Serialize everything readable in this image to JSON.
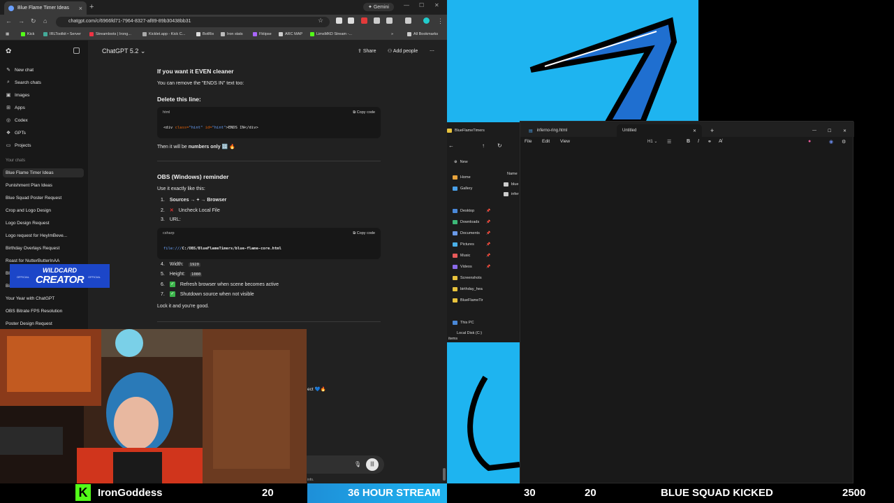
{
  "browser": {
    "tab_title": "Blue Flame Timer Ideas",
    "gemini_label": "Gemini",
    "url": "chatgpt.com/c/6966fd71-7964-8327-af89-89b30438bb31",
    "bookmarks": [
      "Kick",
      "IRLToolkit • Server",
      "Streamloots | Irong...",
      "Kicklet.app - Kick C...",
      "BotRix",
      "Iron stats",
      "Fktipse",
      "ARC MAP",
      "LimsMKD Stream -..."
    ],
    "all_bookmarks": "All Bookmarks"
  },
  "sidebar": {
    "top_items": [
      {
        "icon": "new-chat-icon",
        "label": "New chat"
      },
      {
        "icon": "search-icon",
        "label": "Search chats"
      },
      {
        "icon": "images-icon",
        "label": "Images"
      },
      {
        "icon": "apps-icon",
        "label": "Apps"
      },
      {
        "icon": "codex-icon",
        "label": "Codex"
      },
      {
        "icon": "gpts-icon",
        "label": "GPTs"
      },
      {
        "icon": "projects-icon",
        "label": "Projects"
      }
    ],
    "section_label": "Your chats",
    "chats": [
      "Blue Flame Timer Ideas",
      "Punishment Plan Ideas",
      "Blue Squad Poster Request",
      "Crop and Logo Design",
      "Logo Design Request",
      "Logo request for HeyImBeve...",
      "Birthday Overlays Request",
      "Roast for NutterButterInAA",
      "Bl",
      "Bi",
      "Your Year with ChatGPT",
      "OBS Bitrate FPS Resolution",
      "Poster Design Request"
    ]
  },
  "chat": {
    "model": "ChatGPT 5.2",
    "share": "Share",
    "add_people": "Add people",
    "heading1": "If you want it EVEN cleaner",
    "p1": "You can remove the \"ENDS IN\" text too:",
    "delete_line": "Delete this line:",
    "code1_lang": "html",
    "copy_code": "Copy code",
    "code1_tag_open": "<div ",
    "code1_attr1": "class=",
    "code1_str1": "\"hint\"",
    "code1_attr2": " id=",
    "code1_str2": "\"hint\"",
    "code1_rest": ">ENDS IN</div>",
    "then_prefix": "Then it will be ",
    "then_bold": "numbers only",
    "then_emoji": "🔢 🔥",
    "heading2": "OBS (Windows) reminder",
    "use_exactly": "Use it exactly like this:",
    "steps": [
      {
        "num": "1.",
        "text": "Sources → + → Browser"
      },
      {
        "num": "2.",
        "text": "Uncheck Local File"
      },
      {
        "num": "3.",
        "text": "URL:"
      }
    ],
    "code2_lang": "csharp",
    "code2_prefix": "file:///",
    "code2_path": "C:/OBS/BlueFlameTimers/blue-flame-core.html",
    "width_label": "Width:",
    "width_val": "1920",
    "height_label": "Height:",
    "height_val": "1080",
    "step6": "Refresh browser when scene becomes active",
    "step7": "Shutdown source when not visible",
    "nums_rest": [
      "4.",
      "5.",
      "6.",
      "7."
    ],
    "lock": "Lock it and you're good.",
    "partial": "ect 💙🔥",
    "fineprint": "info."
  },
  "badge": {
    "top": "WILDCARD",
    "main": "CREATOR",
    "side": "OFFICIAL"
  },
  "explorer": {
    "title": "BlueFlameTimers",
    "new": "New",
    "col": "Name",
    "nav": [
      {
        "label": "Home",
        "color": "#e8a33c"
      },
      {
        "label": "Gallery",
        "color": "#4aa0e8"
      },
      {
        "label": "Desktop",
        "color": "#4a88d8"
      },
      {
        "label": "Downloads",
        "color": "#3cb878"
      },
      {
        "label": "Documents",
        "color": "#6a9ae8"
      },
      {
        "label": "Pictures",
        "color": "#4ab0e8"
      },
      {
        "label": "Music",
        "color": "#e85a5a"
      },
      {
        "label": "Videos",
        "color": "#8a6ae8"
      },
      {
        "label": "Screenshots",
        "color": "#e8c23c"
      },
      {
        "label": "birthday_hea",
        "color": "#e8c23c"
      },
      {
        "label": "BlueFlameTir",
        "color": "#e8c23c"
      }
    ],
    "files": [
      "blue",
      "infer"
    ],
    "this_pc": "This PC",
    "local_disk": "Local Disk (C:)",
    "items": "items"
  },
  "notepad": {
    "tabs": [
      "inferno-ring.html",
      "Untitled"
    ],
    "menu": [
      "File",
      "Edit",
      "View"
    ],
    "heading_btn": "H1"
  },
  "ticker": {
    "name": "IronGoddess",
    "n1": "20",
    "stream": "36 HOUR STREAM",
    "n2": "30",
    "n3": "20",
    "kicked": "BLUE SQUAD KICKED",
    "n4": "2500"
  },
  "colors": {
    "accent_blue": "#1eb4f0",
    "kick_green": "#53fc18",
    "badge_blue": "#1c46c8"
  }
}
